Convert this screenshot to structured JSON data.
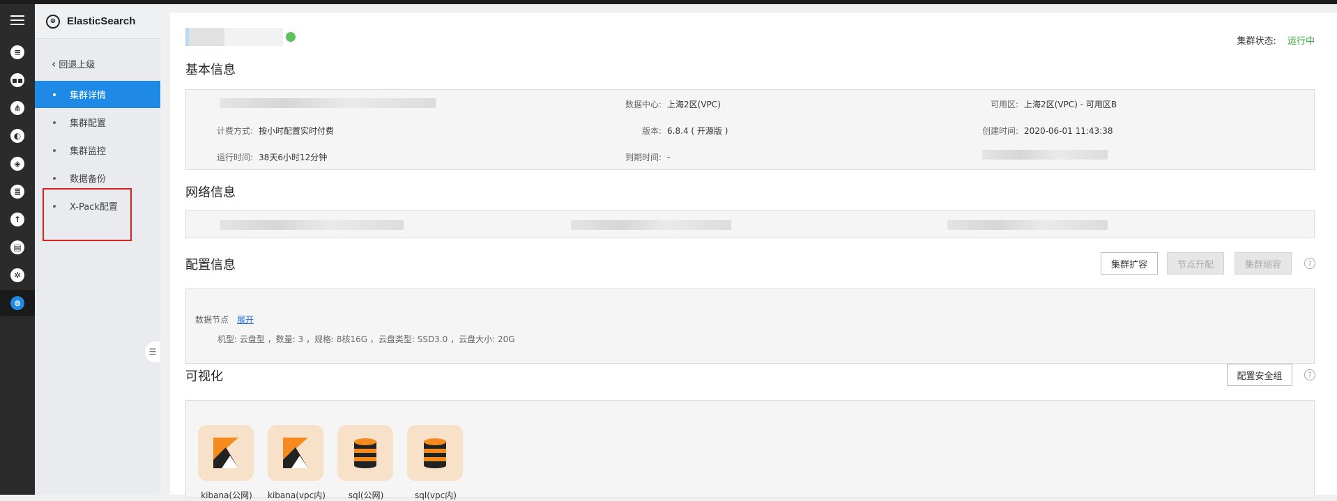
{
  "app": {
    "title": "ElasticSearch"
  },
  "rail": {
    "icons": [
      "menu-icon",
      "server-icon",
      "cluster-icon",
      "network-icon",
      "cloud-icon",
      "layers-icon",
      "database-icon",
      "upload-icon",
      "monitor-icon",
      "settings-icon",
      "elasticsearch-icon"
    ]
  },
  "sidebar": {
    "back_label": "回退上级",
    "items": [
      {
        "label": "集群详情",
        "active": true
      },
      {
        "label": "集群配置"
      },
      {
        "label": "集群监控"
      },
      {
        "label": "数据备份"
      },
      {
        "label": "X-Pack配置"
      }
    ]
  },
  "header": {
    "status_label": "集群状态:",
    "status_value": "运行中",
    "status_color": "#2fa92f"
  },
  "basic": {
    "title": "基本信息",
    "datacenter_label": "数据中心:",
    "datacenter_value": "上海2区(VPC)",
    "zone_label": "可用区:",
    "zone_value": "上海2区(VPC) - 可用区B",
    "billing_label": "计费方式:",
    "billing_value": "按小时配置实时付费",
    "version_label": "版本:",
    "version_value": "6.8.4 ( 开源版 )",
    "created_label": "创建时间:",
    "created_value": "2020-06-01 11:43:38",
    "uptime_label": "运行时间:",
    "uptime_value": "38天6小时12分钟",
    "expire_label": "到期时间:",
    "expire_value": "-"
  },
  "network": {
    "title": "网络信息"
  },
  "config": {
    "title": "配置信息",
    "btn_expand": "集群扩容",
    "btn_upgrade": "节点升配",
    "btn_shrink": "集群缩容",
    "help": "?",
    "node_label": "数据节点",
    "expand_link": "展开",
    "spec": "机型: 云盘型 ，数量: 3 ，规格: 8核16G ，云盘类型: SSD3.0 ，云盘大小: 20G"
  },
  "visual": {
    "title": "可视化",
    "btn_security": "配置安全组",
    "help": "?",
    "tiles": [
      {
        "label": "kibana(公网)",
        "icon": "kibana-icon"
      },
      {
        "label": "kibana(vpc内)",
        "icon": "kibana-icon"
      },
      {
        "label": "sql(公网)",
        "icon": "database-icon"
      },
      {
        "label": "sql(vpc内)",
        "icon": "database-icon"
      }
    ]
  },
  "colors": {
    "accent": "#1e8ae6",
    "highlight": "#e02020"
  }
}
